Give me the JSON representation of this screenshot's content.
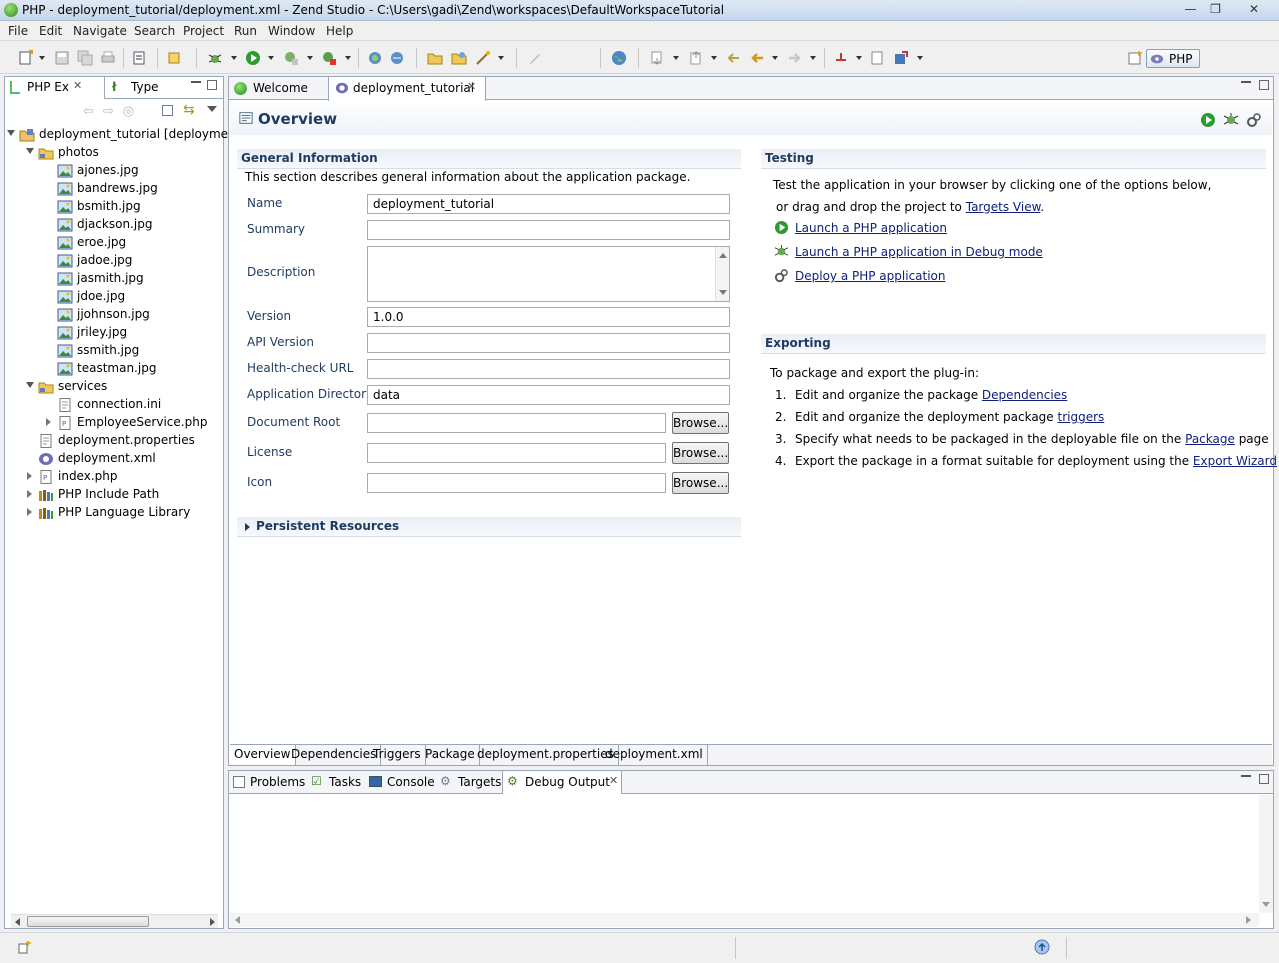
{
  "window": {
    "title": "PHP - deployment_tutorial/deployment.xml - Zend Studio - C:\\Users\\gadi\\Zend\\workspaces\\DefaultWorkspaceTutorial",
    "minimize": "—",
    "maximize": "❐",
    "close": "✕"
  },
  "menu": [
    "File",
    "Edit",
    "Navigate",
    "Search",
    "Project",
    "Run",
    "Window",
    "Help"
  ],
  "perspective": {
    "label": "PHP"
  },
  "left_panel": {
    "tabs": [
      {
        "label": "PHP Ex"
      },
      {
        "label": "Type"
      }
    ],
    "tree": [
      {
        "label": "deployment_tutorial [deploymer",
        "level": 0,
        "expanded": true,
        "icon": "project-icon"
      },
      {
        "label": "photos",
        "level": 1,
        "expanded": true,
        "icon": "folder-icon"
      },
      {
        "label": "ajones.jpg",
        "level": 2,
        "icon": "image-icon"
      },
      {
        "label": "bandrews.jpg",
        "level": 2,
        "icon": "image-icon"
      },
      {
        "label": "bsmith.jpg",
        "level": 2,
        "icon": "image-icon"
      },
      {
        "label": "djackson.jpg",
        "level": 2,
        "icon": "image-icon"
      },
      {
        "label": "eroe.jpg",
        "level": 2,
        "icon": "image-icon"
      },
      {
        "label": "jadoe.jpg",
        "level": 2,
        "icon": "image-icon"
      },
      {
        "label": "jasmith.jpg",
        "level": 2,
        "icon": "image-icon"
      },
      {
        "label": "jdoe.jpg",
        "level": 2,
        "icon": "image-icon"
      },
      {
        "label": "jjohnson.jpg",
        "level": 2,
        "icon": "image-icon"
      },
      {
        "label": "jriley.jpg",
        "level": 2,
        "icon": "image-icon"
      },
      {
        "label": "ssmith.jpg",
        "level": 2,
        "icon": "image-icon"
      },
      {
        "label": "teastman.jpg",
        "level": 2,
        "icon": "image-icon"
      },
      {
        "label": "services",
        "level": 1,
        "expanded": true,
        "icon": "folder-icon"
      },
      {
        "label": "connection.ini",
        "level": 2,
        "icon": "file-icon"
      },
      {
        "label": "EmployeeService.php",
        "level": 2,
        "expanded": false,
        "icon": "php-file-icon"
      },
      {
        "label": "deployment.properties",
        "level": 1,
        "icon": "file-icon"
      },
      {
        "label": "deployment.xml",
        "level": 1,
        "icon": "xml-file-icon"
      },
      {
        "label": "index.php",
        "level": 1,
        "expanded": false,
        "icon": "php-file-icon"
      },
      {
        "label": "PHP Include Path",
        "level": 1,
        "expanded": false,
        "icon": "library-icon"
      },
      {
        "label": "PHP Language Library",
        "level": 1,
        "expanded": false,
        "icon": "library-icon"
      }
    ]
  },
  "editor": {
    "tabs": [
      {
        "label": "Welcome"
      },
      {
        "label": "deployment_tutorial",
        "active": true
      }
    ],
    "form_title": "Overview",
    "general": {
      "title": "General Information",
      "description": "This section describes general information about the application package.",
      "fields": [
        {
          "label": "Name",
          "value": "deployment_tutorial"
        },
        {
          "label": "Summary",
          "value": ""
        },
        {
          "label": "Description",
          "value": ""
        },
        {
          "label": "Version",
          "value": "1.0.0"
        },
        {
          "label": "API Version",
          "value": ""
        },
        {
          "label": "Health-check URL",
          "value": ""
        },
        {
          "label": "Application Directory",
          "value": "data"
        },
        {
          "label": "Document Root",
          "value": ""
        },
        {
          "label": "License",
          "value": ""
        },
        {
          "label": "Icon",
          "value": ""
        }
      ],
      "browse_label": "Browse..."
    },
    "persistent": {
      "title": "Persistent Resources"
    },
    "testing": {
      "title": "Testing",
      "line1": "Test the application in your browser by clicking one of the options below,",
      "line2_prefix": "or drag and drop the project to ",
      "line2_link": "Targets View",
      "line2_suffix": ".",
      "links": [
        "Launch a PHP application",
        "Launch a PHP application in Debug mode",
        "Deploy a PHP application"
      ]
    },
    "exporting": {
      "title": "Exporting",
      "intro": "To package and export the plug-in:",
      "steps": [
        {
          "num": "1.",
          "prefix": "Edit and organize the package ",
          "link": "Dependencies",
          "suffix": ""
        },
        {
          "num": "2.",
          "prefix": "Edit and organize the deployment package ",
          "link": "triggers",
          "suffix": ""
        },
        {
          "num": "3.",
          "prefix": "Specify what needs to be packaged in the deployable file on the ",
          "link": "Package",
          "suffix": " page"
        },
        {
          "num": "4.",
          "prefix": "Export the package in a format suitable for deployment using the ",
          "link": "Export Wizard",
          "suffix": ""
        }
      ]
    },
    "bottom_tabs": [
      "Overview",
      "Dependencies",
      "Triggers",
      "Package",
      "deployment.properties",
      "deployment.xml"
    ]
  },
  "console": {
    "tabs": [
      "Problems",
      "Tasks",
      "Console",
      "Targets",
      "Debug Output"
    ]
  }
}
